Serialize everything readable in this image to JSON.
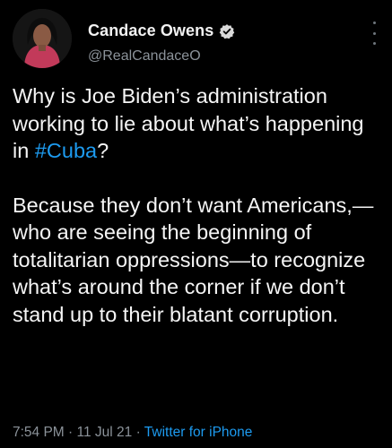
{
  "author": {
    "display_name": "Candace Owens",
    "handle": "@RealCandaceO",
    "verified": true
  },
  "tweet": {
    "para1_before": "Why is Joe Biden’s administration working to lie about what’s happening in ",
    "hashtag": "#Cuba",
    "para1_after": "?",
    "para2": "Because they don’t want Americans,—who are seeing the beginning of totalitarian oppressions—to recognize what’s around the corner if we don’t stand up to their blatant corruption."
  },
  "meta": {
    "time": "7:54 PM",
    "separator": " · ",
    "date": "11 Jul 21",
    "source": "Twitter for iPhone"
  },
  "colors": {
    "background": "#000000",
    "link": "#1d9bf0",
    "secondary_text": "#8b9299"
  },
  "icons": [
    "verified-badge-icon",
    "more-options-icon"
  ]
}
